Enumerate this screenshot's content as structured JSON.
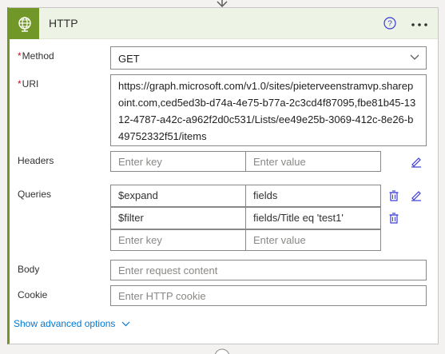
{
  "header": {
    "title": "HTTP",
    "icon": "globe-icon",
    "accent": "#709727"
  },
  "method": {
    "label": "Method",
    "required_mark": "*",
    "value": "GET"
  },
  "uri": {
    "label": "URI",
    "required_mark": "*",
    "value": "https://graph.microsoft.com/v1.0/sites/pieterveenstramvp.sharepoint.com,ced5ed3b-d74a-4e75-b77a-2c3cd4f87095,fbe81b45-1312-4787-a42c-a962f2d0c531/Lists/ee49e25b-3069-412c-8e26-b49752332f51/items"
  },
  "headers": {
    "label": "Headers",
    "key_placeholder": "Enter key",
    "value_placeholder": "Enter value"
  },
  "queries": {
    "label": "Queries",
    "rows": [
      {
        "key": "$expand",
        "value": "fields"
      },
      {
        "key": "$filter",
        "value": "fields/Title eq 'test1'"
      }
    ],
    "key_placeholder": "Enter key",
    "value_placeholder": "Enter value"
  },
  "body": {
    "label": "Body",
    "placeholder": "Enter request content"
  },
  "cookie": {
    "label": "Cookie",
    "placeholder": "Enter HTTP cookie"
  },
  "advanced": {
    "label": "Show advanced options"
  },
  "colors": {
    "link": "#0078d4",
    "required": "#c50f1f",
    "border": "#8a8886"
  }
}
